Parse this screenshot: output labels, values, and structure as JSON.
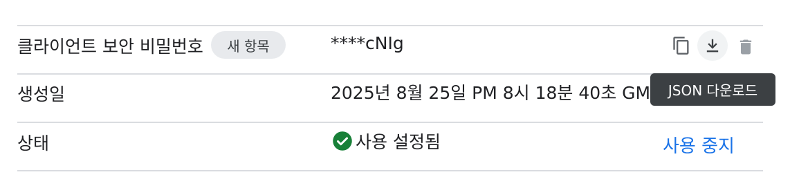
{
  "secret": {
    "label": "클라이언트 보안 비밀번호",
    "chip": "새 항목",
    "value": "****cNIg",
    "actions": {
      "copy_icon": "copy-icon",
      "download_icon": "download-icon",
      "delete_icon": "trash-icon"
    }
  },
  "tooltip": {
    "text": "JSON 다운로드"
  },
  "created": {
    "label": "생성일",
    "value": "2025년 8월 25일 PM 8시 18분 40초 GM"
  },
  "status": {
    "label": "상태",
    "value": "사용 설정됨",
    "icon": "check-circle-icon",
    "action": "사용 중지"
  },
  "colors": {
    "divider": "#dadce0",
    "link": "#1a73e8",
    "success": "#188038",
    "chip_bg": "#e8eaed",
    "tooltip_bg": "#3c4043"
  }
}
